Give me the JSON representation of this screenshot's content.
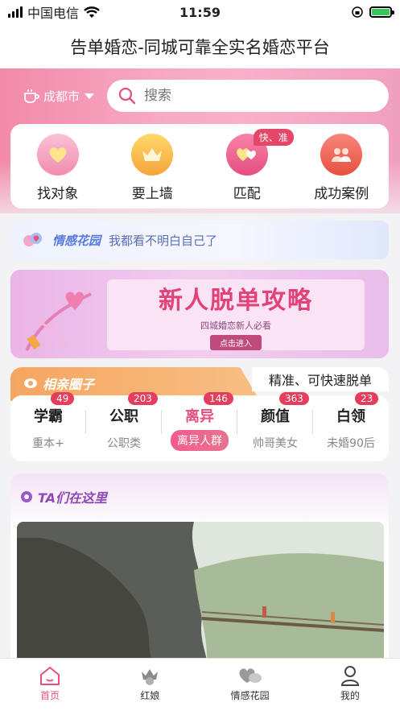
{
  "status": {
    "carrier": "中国电信",
    "time": "11:59"
  },
  "header": {
    "title": "告单婚恋-同城可靠全实名婚恋平台"
  },
  "location": {
    "city": "成都市"
  },
  "search": {
    "placeholder": "搜索"
  },
  "quick_actions": [
    {
      "label": "找对象",
      "icon": "heart-icon"
    },
    {
      "label": "要上墙",
      "icon": "crown-icon"
    },
    {
      "label": "匹配",
      "icon": "match-hearts-icon",
      "badge": "快、准"
    },
    {
      "label": "成功案例",
      "icon": "couple-icon"
    }
  ],
  "garden": {
    "logo": "情感花园",
    "text": "我都看不明白自己了"
  },
  "banner": {
    "title": "新人脱单攻略",
    "subtitle": "四城婚恋新人必看",
    "button": "点击进入"
  },
  "circle": {
    "tab_label": "相亲圈子",
    "tagline": "精准、可快速脱单"
  },
  "categories": [
    {
      "title": "学霸",
      "sub": "重本+",
      "count": "49"
    },
    {
      "title": "公职",
      "sub": "公职类",
      "count": "203"
    },
    {
      "title": "离异",
      "sub": "离异人群",
      "count": "146",
      "active": true
    },
    {
      "title": "颜值",
      "sub": "帅哥美女",
      "count": "363"
    },
    {
      "title": "白领",
      "sub": "未婚90后",
      "count": "23"
    }
  ],
  "featured": {
    "title": "TA们在这里"
  },
  "tabbar": [
    {
      "label": "首页",
      "icon": "home-icon",
      "active": true
    },
    {
      "label": "红娘",
      "icon": "matchmaker-icon"
    },
    {
      "label": "情感花园",
      "icon": "chat-heart-icon"
    },
    {
      "label": "我的",
      "icon": "profile-icon"
    }
  ],
  "colors": {
    "accent": "#e5507c",
    "badge": "#e53e5d",
    "circle_tab": "#f6a661"
  }
}
